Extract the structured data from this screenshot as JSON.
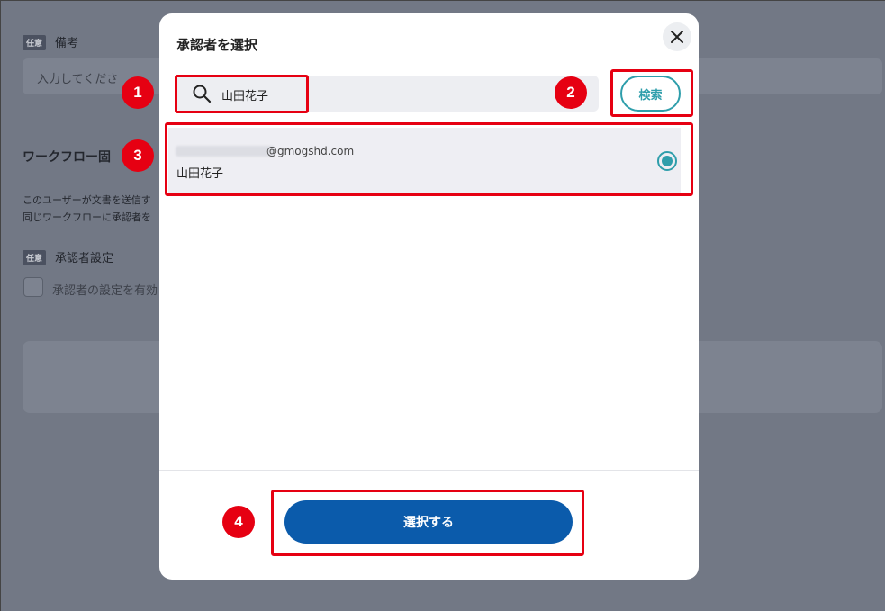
{
  "background": {
    "badge_label": "任意",
    "remarks_label": "備考",
    "remarks_placeholder": "入力してくださ",
    "workflow_heading": "ワークフロー固",
    "description_line1": "このユーザーが文書を送信す",
    "description_line2": "同じワークフローに承認者を",
    "approver_setting_label": "承認者設定",
    "approver_checkbox_label": "承認者の設定を有効"
  },
  "modal": {
    "title": "承認者を選択",
    "close_icon": "close-icon",
    "search": {
      "icon": "search-icon",
      "value": "山田花子",
      "button_label": "検索"
    },
    "result": {
      "email_domain": "@gmogshd.com",
      "name": "山田花子",
      "selected": true
    },
    "select_button_label": "選択する"
  },
  "annotations": [
    "1",
    "2",
    "3",
    "4"
  ],
  "colors": {
    "accent": "#2e9eab",
    "primary": "#0b5bab",
    "annotation": "#e60012"
  }
}
